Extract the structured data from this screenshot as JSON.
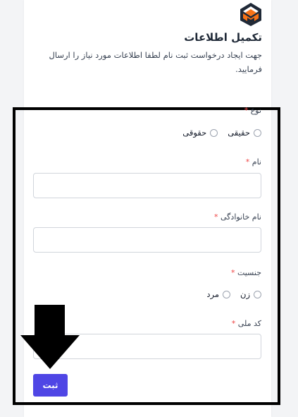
{
  "header": {
    "title": "تکمیل اطلاعات",
    "subtitle": "جهت ایجاد درخواست ثبت نام لطفا اطلاعات مورد نیاز را ارسال فرمایید."
  },
  "form": {
    "type": {
      "label": "نوع",
      "required_mark": "*",
      "options": [
        {
          "label": "حقیقی",
          "selected": false
        },
        {
          "label": "حقوقی",
          "selected": false
        }
      ]
    },
    "first_name": {
      "label": "نام",
      "required_mark": "*",
      "value": ""
    },
    "last_name": {
      "label": "نام خانوادگی",
      "required_mark": "*",
      "value": ""
    },
    "gender": {
      "label": "جنسیت",
      "required_mark": "*",
      "options": [
        {
          "label": "زن",
          "selected": false
        },
        {
          "label": "مرد",
          "selected": false
        }
      ]
    },
    "national_code": {
      "label": "کد ملی",
      "required_mark": "*",
      "value": ""
    },
    "submit_label": "ثبت"
  },
  "colors": {
    "accent": "#4f46e5",
    "required": "#ef4444",
    "logo_orange": "#f97316",
    "logo_dark": "#1f2937"
  }
}
